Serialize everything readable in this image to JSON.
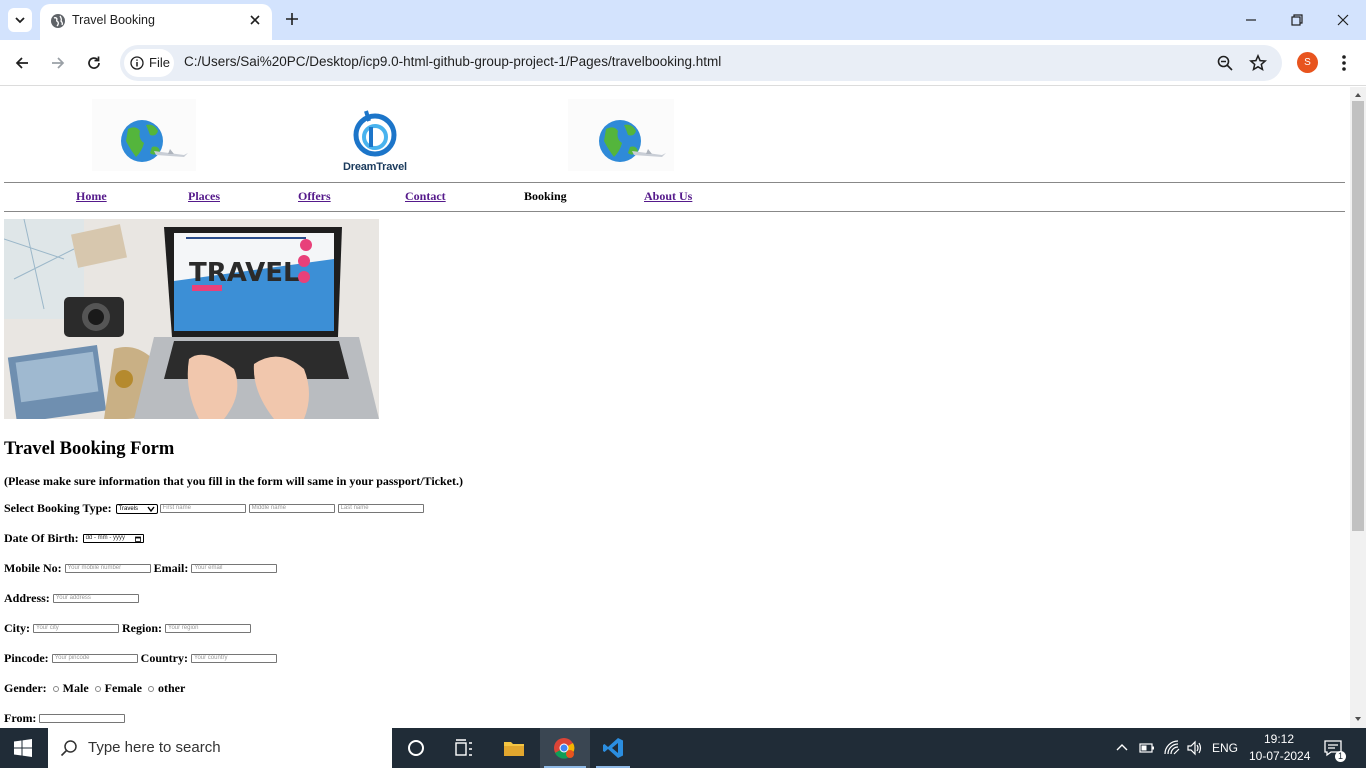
{
  "browser": {
    "tab_title": "Travel Booking",
    "omnibox_chip": "File",
    "url": "C:/Users/Sai%20PC/Desktop/icp9.0-html-github-group-project-1/Pages/travelbooking.html",
    "profile_initial": "S",
    "icons": [
      "tab-search-icon",
      "globe-icon",
      "close-icon",
      "plus-icon",
      "minimize-icon",
      "restore-icon",
      "window-close-icon",
      "back-icon",
      "forward-icon",
      "reload-icon",
      "info-icon",
      "zoom-icon",
      "star-icon",
      "more-icon"
    ]
  },
  "site": {
    "brand": "DreamTravel",
    "nav": [
      {
        "label": "Home"
      },
      {
        "label": "Places"
      },
      {
        "label": "Offers"
      },
      {
        "label": "Contact"
      },
      {
        "label": "Booking"
      },
      {
        "label": "About Us"
      }
    ],
    "hero_text": "TRAVEL"
  },
  "form": {
    "title": "Travel Booking Form",
    "note": "(Please make sure information that you fill in the form will same in your passport/Ticket.)",
    "booking_type_label": "Select Booking Type:",
    "booking_type_value": "Travels",
    "first_name_ph": "First name",
    "middle_name_ph": "Middle name",
    "last_name_ph": "Last name",
    "dob_label": "Date Of Birth:",
    "dob_ph": "dd - mm - yyyy",
    "mobile_label": "Mobile No:",
    "mobile_ph": "Your mobile number",
    "email_label": "Email:",
    "email_ph": "Your email",
    "address_label": "Address:",
    "address_ph": "Your address",
    "city_label": "City:",
    "city_ph": "Your city",
    "region_label": "Region:",
    "region_ph": "Your region",
    "pincode_label": "Pincode:",
    "pincode_ph": "Your pincode",
    "country_label": "Country:",
    "country_ph": "Your country",
    "gender_label": "Gender:",
    "gender_options": [
      "Male",
      "Female",
      "other"
    ],
    "from_label": "From:"
  },
  "taskbar": {
    "search_placeholder": "Type here to search",
    "language": "ENG",
    "time": "19:12",
    "date": "10-07-2024",
    "notification_count": "1"
  }
}
